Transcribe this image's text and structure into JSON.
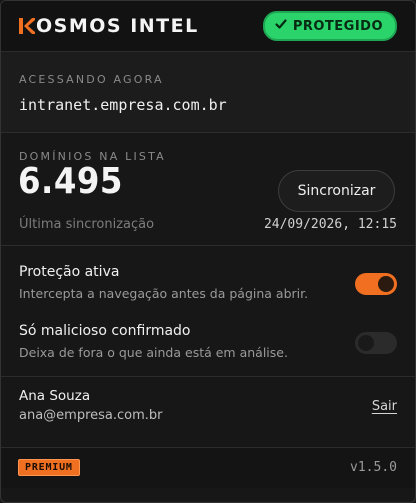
{
  "header": {
    "brand_rest": "OSMOS INTEL",
    "brand_accent_color": "#f06f20",
    "status_label": "PROTEGIDO",
    "status_icon": "check-icon"
  },
  "access": {
    "caption": "ACESSANDO AGORA",
    "site": "intranet.empresa.com.br"
  },
  "domains": {
    "caption": "DOMÍNIOS NA LISTA",
    "count": "6.495",
    "sync_button": "Sincronizar",
    "last_sync_label": "Última sincronização",
    "last_sync_value": "24/09/2026, 12:15"
  },
  "toggles": [
    {
      "title": "Proteção ativa",
      "description": "Intercepta a navegação antes da página abrir.",
      "enabled": true
    },
    {
      "title": "Só malicioso confirmado",
      "description": "Deixa de fora o que ainda está em análise.",
      "enabled": false
    }
  ],
  "account": {
    "name": "Ana Souza",
    "email": "ana@empresa.com.br",
    "logout": "Sair"
  },
  "footer": {
    "plan": "PREMIUM",
    "version": "v1.5.0"
  }
}
